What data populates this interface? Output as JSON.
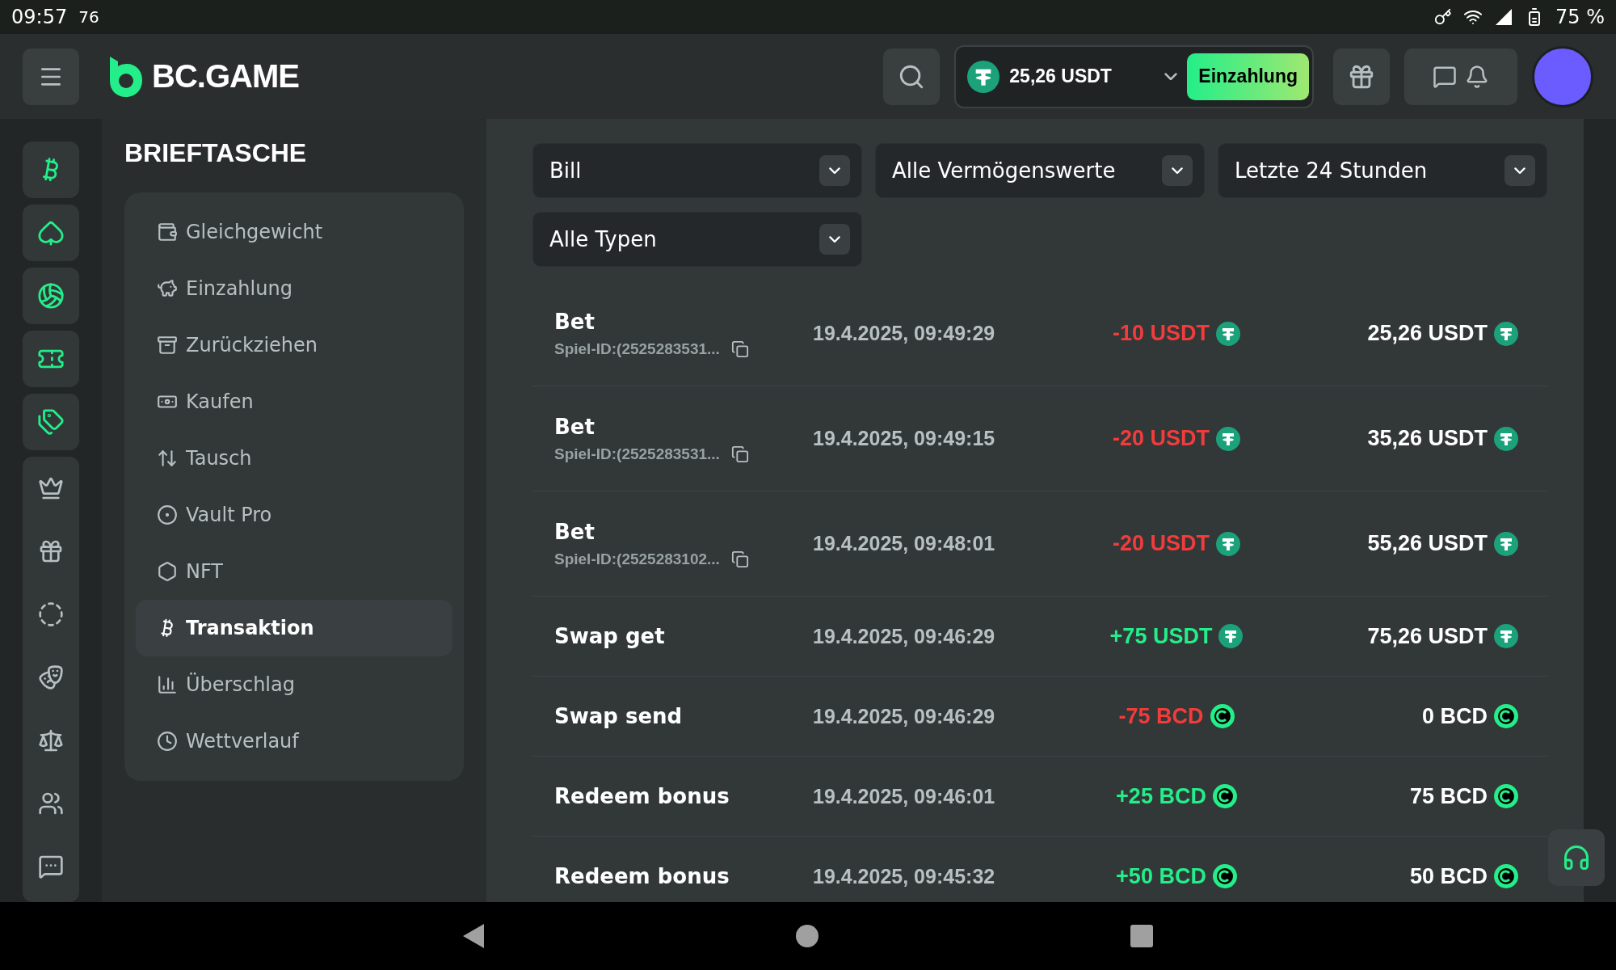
{
  "status_bar": {
    "time": "09:57",
    "extra": "76",
    "battery": "75 %"
  },
  "header": {
    "logo": "BC.GAME",
    "balance": "25,26 USDT",
    "deposit_button": "Einzahlung"
  },
  "wallet": {
    "title": "BRIEFTASCHE",
    "menu": [
      {
        "label": "Gleichgewicht",
        "selected": false
      },
      {
        "label": "Einzahlung",
        "selected": false
      },
      {
        "label": "Zurückziehen",
        "selected": false
      },
      {
        "label": "Kaufen",
        "selected": false
      },
      {
        "label": "Tausch",
        "selected": false
      },
      {
        "label": "Vault Pro",
        "selected": false
      },
      {
        "label": "NFT",
        "selected": false
      },
      {
        "label": "Transaktion",
        "selected": true
      },
      {
        "label": "Überschlag",
        "selected": false
      },
      {
        "label": "Wettverlauf",
        "selected": false
      }
    ]
  },
  "filters": [
    {
      "value": "Bill"
    },
    {
      "value": "Alle Vermögenswerte"
    },
    {
      "value": "Letzte 24 Stunden"
    },
    {
      "value": "Alle Typen"
    }
  ],
  "transactions": [
    {
      "type": "Bet",
      "game_id": "Spiel-ID:(2525283531...",
      "time": "19.4.2025, 09:49:29",
      "amount": "-10 USDT",
      "color": "#f23c3c",
      "kind": "usdt",
      "balance": "25,26 USDT"
    },
    {
      "type": "Bet",
      "game_id": "Spiel-ID:(2525283531...",
      "time": "19.4.2025, 09:49:15",
      "amount": "-20 USDT",
      "color": "#f23c3c",
      "kind": "usdt",
      "balance": "35,26 USDT"
    },
    {
      "type": "Bet",
      "game_id": "Spiel-ID:(2525283102...",
      "time": "19.4.2025, 09:48:01",
      "amount": "-20 USDT",
      "color": "#f23c3c",
      "kind": "usdt",
      "balance": "55,26 USDT"
    },
    {
      "type": "Swap get",
      "time": "19.4.2025, 09:46:29",
      "amount": "+75 USDT",
      "color": "#24ee89",
      "kind": "usdt",
      "balance": "75,26 USDT"
    },
    {
      "type": "Swap send",
      "time": "19.4.2025, 09:46:29",
      "amount": "-75 BCD",
      "color": "#f23c3c",
      "kind": "bcd",
      "balance": "0 BCD"
    },
    {
      "type": "Redeem bonus",
      "time": "19.4.2025, 09:46:01",
      "amount": "+25 BCD",
      "color": "#24ee89",
      "kind": "bcd",
      "balance": "75 BCD"
    },
    {
      "type": "Redeem bonus",
      "time": "19.4.2025, 09:45:32",
      "amount": "+50 BCD",
      "color": "#24ee89",
      "kind": "bcd",
      "balance": "50 BCD"
    }
  ]
}
